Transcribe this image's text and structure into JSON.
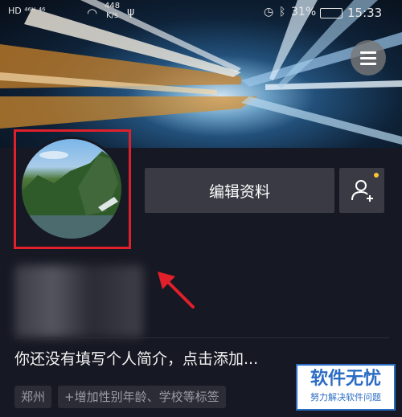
{
  "status_bar": {
    "left_text": "HD ⁴⁶ᴴ ⁴⁶",
    "speed": "448",
    "speed_unit": "K/s",
    "battery": "31%",
    "time": "15:33"
  },
  "profile": {
    "edit_button_label": "编辑资料",
    "bio": "你还没有填写个人简介，点击添加...",
    "tags": [
      "郑州",
      "+增加性别年龄、学校等标签"
    ]
  },
  "watermark": {
    "title": "软件无忧",
    "subtitle": "努力解决软件问题"
  },
  "colors": {
    "background": "#161823",
    "button": "#3a3a44",
    "highlight_box": "#e0202a",
    "notification_dot": "#f6c531"
  }
}
